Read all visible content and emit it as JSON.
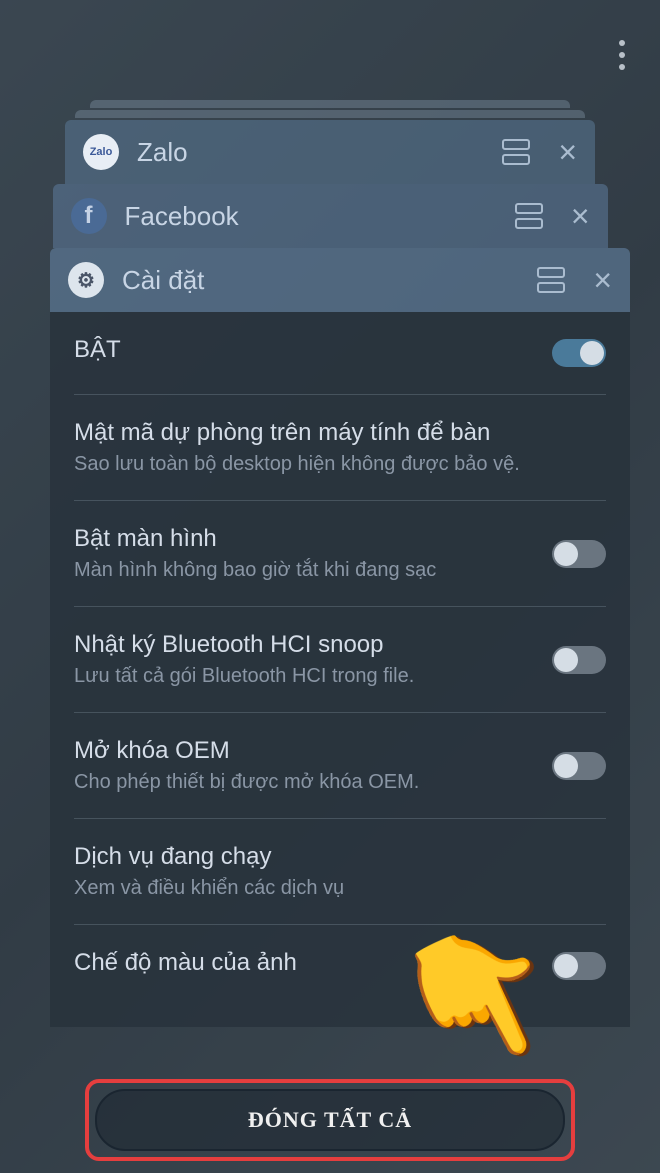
{
  "apps": {
    "zalo": "Zalo",
    "facebook": "Facebook",
    "settings": "Cài đặt"
  },
  "settings": {
    "bat": {
      "title": "BẬT"
    },
    "backup": {
      "title": "Mật mã dự phòng trên máy tính để bàn",
      "sub": "Sao lưu toàn bộ desktop hiện không được bảo vệ."
    },
    "screen": {
      "title": "Bật màn hình",
      "sub": "Màn hình không bao giờ tắt khi đang sạc"
    },
    "bluetooth": {
      "title": "Nhật ký Bluetooth HCI snoop",
      "sub": "Lưu tất cả gói Bluetooth HCI trong file."
    },
    "oem": {
      "title": "Mở khóa OEM",
      "sub": "Cho phép thiết bị được mở khóa OEM."
    },
    "services": {
      "title": "Dịch vụ đang chạy",
      "sub": "Xem và điều khiển các dịch vụ"
    },
    "color": {
      "title": "Chế độ màu của ảnh"
    }
  },
  "closeAll": "ĐÓNG TẤT CẢ"
}
